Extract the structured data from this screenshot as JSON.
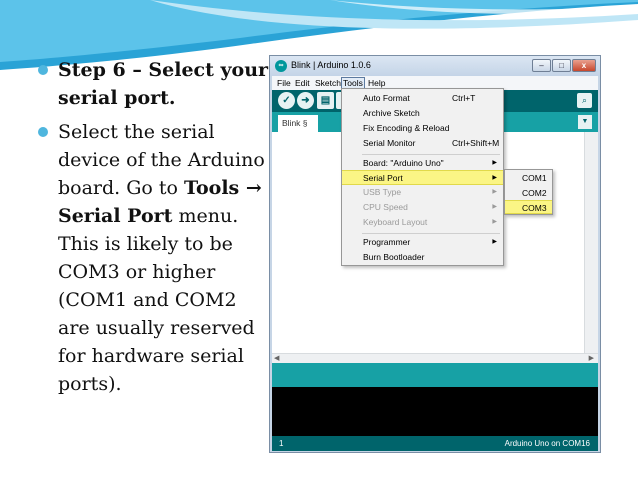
{
  "slide": {
    "bullet1": "Step 6 – Select your serial port.",
    "bullet2": {
      "part1": "Select the serial device of the Arduino board. Go to ",
      "bold1": "Tools → Serial Port",
      "part2": " menu. This is likely to be COM3 or higher (COM1 and COM2 are usually reserved for hardware serial ports)."
    }
  },
  "window": {
    "title": "Blink | Arduino 1.0.6",
    "icon_text": "∞",
    "controls": {
      "minimize": "–",
      "maximize": "□",
      "close": "x"
    }
  },
  "menubar": [
    "File",
    "Edit",
    "Sketch",
    "Tools",
    "Help"
  ],
  "toolbar": {
    "verify": "✓",
    "upload": "➜",
    "new": "▤",
    "open": "↑",
    "save": "↓",
    "serial_monitor": "⌕"
  },
  "tab": {
    "label": "Blink §",
    "menu": "▼"
  },
  "tools_menu": {
    "items": [
      {
        "label": "Auto Format",
        "shortcut": "Ctrl+T"
      },
      {
        "label": "Archive Sketch",
        "shortcut": ""
      },
      {
        "label": "Fix Encoding & Reload",
        "shortcut": ""
      },
      {
        "label": "Serial Monitor",
        "shortcut": "Ctrl+Shift+M"
      },
      {
        "label": "Board: \"Arduino Uno\"",
        "shortcut": ""
      },
      {
        "label": "Serial Port",
        "shortcut": ""
      },
      {
        "label": "USB Type",
        "shortcut": ""
      },
      {
        "label": "CPU Speed",
        "shortcut": ""
      },
      {
        "label": "Keyboard Layout",
        "shortcut": ""
      },
      {
        "label": "Programmer",
        "shortcut": ""
      },
      {
        "label": "Burn Bootloader",
        "shortcut": ""
      }
    ],
    "arrow": "▶"
  },
  "serial_submenu": [
    "COM1",
    "COM2",
    "COM3"
  ],
  "scroll": {
    "left": "◀",
    "right": "▶"
  },
  "status": {
    "line": "1",
    "board": "Arduino Uno on COM16"
  }
}
